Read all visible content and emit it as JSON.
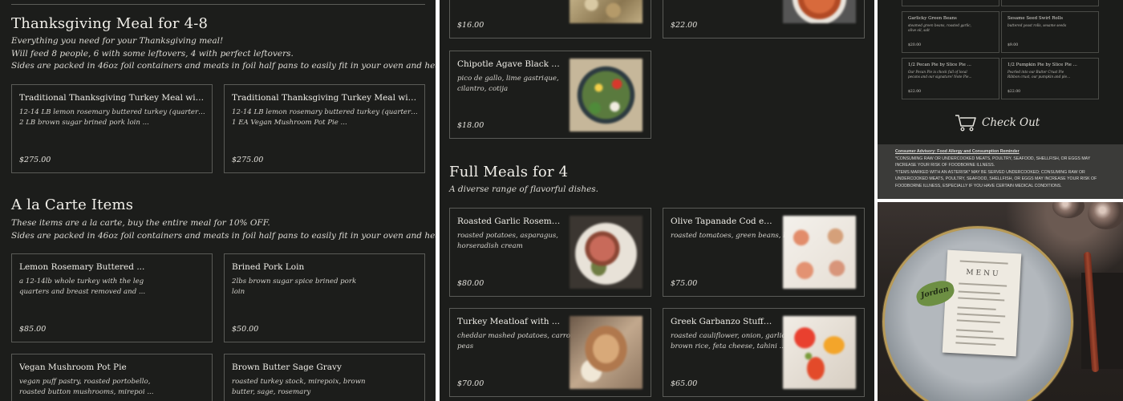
{
  "panel1": {
    "thanksgiving": {
      "title": "Thanksgiving Meal for 4-8",
      "desc": [
        "Everything you need for your Thanksgiving meal!",
        "Will feed 8 people, 6 with some leftovers, 4 with perfect leftovers.",
        "Sides are packed in 46oz foil containers and meats in foil half pans to easily fit in your oven and heat."
      ],
      "items": [
        {
          "name": "Traditional Thanksgiving Turkey Meal with Pork ...",
          "desc": [
            "12-14 LB lemon rosemary buttered turkey (quartered) RAW",
            "2 LB brown sugar brined pork loin ..."
          ],
          "price": "$275.00"
        },
        {
          "name": "Traditional Thanksgiving Turkey Meal with Vegan ...",
          "desc": [
            "12-14 LB lemon rosemary buttered turkey (quartered) RAW",
            "1 EA Vegan Mushroom Pot Pie ..."
          ],
          "price": "$275.00"
        }
      ]
    },
    "alacarte": {
      "title": "A la Carte Items",
      "desc": [
        "These items are a la carte, buy the entire meal for 10% OFF.",
        "Sides are packed in 46oz foil containers and meats in foil half pans to easily fit in your oven and heat."
      ],
      "items": [
        {
          "name": "Lemon Rosemary Buttered ...",
          "desc": [
            "a 12-14lb whole turkey with the leg",
            "quarters and breast removed and ..."
          ],
          "price": "$85.00"
        },
        {
          "name": "Brined Pork Loin",
          "desc": [
            "2lbs brown sugar spice brined pork",
            "loin"
          ],
          "price": "$50.00"
        },
        {
          "name": "Vegan Mushroom Pot Pie",
          "desc": [
            "vegan puff pastry, roasted portobello,",
            "roasted button mushrooms, mirepoi ..."
          ],
          "price": ""
        },
        {
          "name": "Brown Butter Sage Gravy",
          "desc": [
            "roasted turkey stock, mirepoix, brown",
            "butter, sage, rosemary"
          ],
          "price": ""
        }
      ]
    }
  },
  "panel2": {
    "top_prices": [
      "$16.00",
      "$22.00"
    ],
    "chipotle": {
      "name": "Chipotle Agave Black Bean a...",
      "desc": [
        "pico de gallo, lime gastrique,",
        "cilantro, cotija"
      ],
      "price": "$18.00"
    },
    "full_meals": {
      "title": "Full Meals for 4",
      "subtitle": "A diverse range of flavorful dishes.",
      "items": [
        {
          "name": "Roasted Garlic Rosemary ...",
          "desc": [
            "roasted potatoes, asparagus,",
            "horseradish cream"
          ],
          "price": "$80.00"
        },
        {
          "name": "Olive Tapanade Cod en ...",
          "desc": [
            "roasted tomatoes, green beans, lemon"
          ],
          "price": "$75.00"
        },
        {
          "name": "Turkey Meatloaf with ...",
          "desc": [
            "cheddar mashed potatoes, carrots &",
            "peas"
          ],
          "price": "$70.00"
        },
        {
          "name": "Greek Garbanzo Stuffed ...",
          "desc": [
            "roasted cauliflower, onion, garlic,",
            "brown rice, feta cheese, tahini ..."
          ],
          "price": "$65.00"
        }
      ]
    }
  },
  "panel3": {
    "cart_items": [
      {
        "name": "Garlicky Green Beans",
        "desc": [
          "steamed green beans, roasted garlic,",
          "olive oil, salt"
        ],
        "price": "$20.00"
      },
      {
        "name": "Sesame Seed Swirl Rolls",
        "desc": [
          "buttered yeast rolls, sesame seeds"
        ],
        "price": "$9.00"
      },
      {
        "name": "1/2 Pecan Pie by Slice Pie ...",
        "desc": [
          "Our Pecan Pie is chock full of local",
          "pecans and our signature! Note Pie..."
        ],
        "price": "$22.00"
      },
      {
        "name": "1/2 Pumpkin Pie by Slice Pie ...",
        "desc": [
          "Pearled into our Butter Crust Pie",
          "Ribbon crust, our pumpkin and ple..."
        ],
        "price": "$22.00"
      }
    ],
    "checkout_label": "Check Out",
    "advisory": {
      "title": "Consumer Advisory: Food Allergy and Consumption Reminder",
      "lines": [
        "*CONSUMING RAW OR UNDERCOOKED MEATS, POULTRY, SEAFOOD, SHELLFISH, OR EGGS MAY",
        "INCREASE YOUR RISK OF FOODBORNE ILLNESS.",
        "*ITEMS MARKED WITH AN ASTERISK* MAY BE SERVED UNDERCOOKED; CONSUMING RAW OR",
        "UNDERCOOKED MEATS, POULTRY, SEAFOOD, SHELLFISH, OR EGGS MAY INCREASE YOUR RISK OF",
        "FOODBORNE ILLNESS, ESPECIALLY IF YOU HAVE CERTAIN MEDICAL CONDITIONS."
      ]
    }
  },
  "panel4": {
    "menu_title": "MENU",
    "place_name": "Jordan"
  }
}
